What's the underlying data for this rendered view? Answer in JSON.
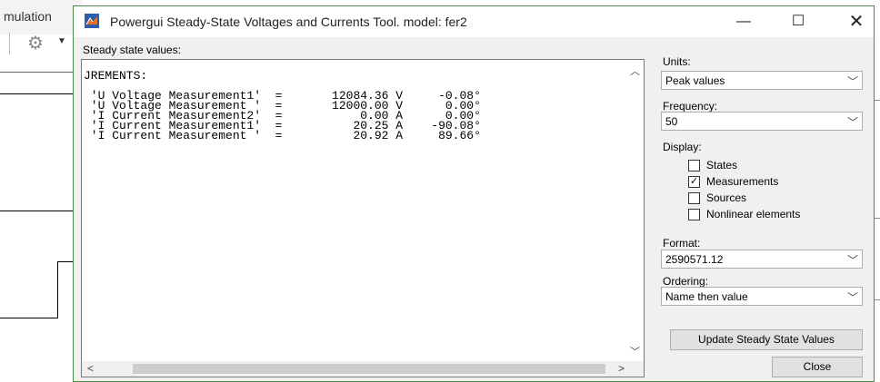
{
  "background_window": {
    "title_partial": "mulation"
  },
  "dialog": {
    "title": "Powergui Steady-State Voltages and Currents Tool.  model: fer2",
    "window_controls": {
      "minimize": "—",
      "maximize": "☐",
      "close": "✕"
    },
    "output_label": "Steady state values:",
    "output_lines": [
      "JREMENTS:",
      "",
      " 'U Voltage Measurement1'  =       12084.36 V     -0.08°",
      " 'U Voltage Measurement '  =       12000.00 V      0.00°",
      " 'I Current Measurement2'  =           0.00 A      0.00°",
      " 'I Current Measurement1'  =          20.25 A    -90.08°",
      " 'I Current Measurement '  =          20.92 A     89.66°"
    ],
    "units": {
      "label": "Units:",
      "value": "Peak values"
    },
    "frequency": {
      "label": "Frequency:",
      "value": "50"
    },
    "display": {
      "label": "Display:",
      "options": [
        {
          "label": "States",
          "checked": false
        },
        {
          "label": "Measurements",
          "checked": true
        },
        {
          "label": "Sources",
          "checked": false
        },
        {
          "label": "Nonlinear elements",
          "checked": false
        }
      ]
    },
    "format": {
      "label": "Format:",
      "value": "2590571.12"
    },
    "ordering": {
      "label": "Ordering:",
      "value": "Name then value"
    },
    "update_button": "Update Steady State Values",
    "close_button": "Close"
  }
}
